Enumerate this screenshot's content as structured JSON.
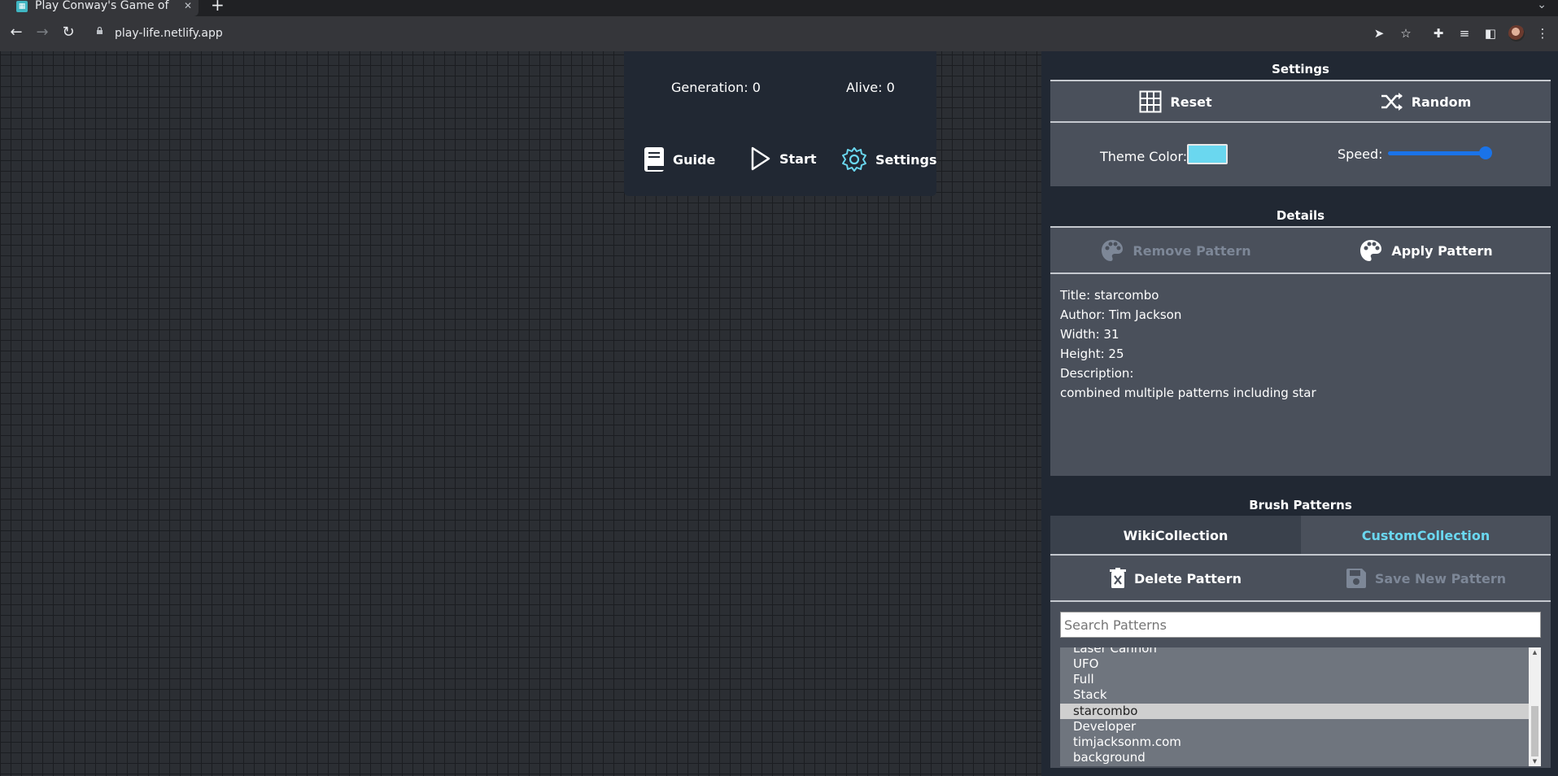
{
  "browser": {
    "tab_title": "Play Conway's Game of Life",
    "url": "play-life.netlify.app"
  },
  "top_panel": {
    "generation_label": "Generation: 0",
    "alive_label": "Alive: 0",
    "guide_label": "Guide",
    "start_label": "Start",
    "settings_label": "Settings"
  },
  "settings": {
    "title": "Settings",
    "reset_label": "Reset",
    "random_label": "Random",
    "theme_color_label": "Theme Color:",
    "theme_color": "#6ad7ef",
    "speed_label": "Speed:",
    "speed_value": 1.0
  },
  "details": {
    "title": "Details",
    "remove_label": "Remove Pattern",
    "apply_label": "Apply Pattern",
    "lines": [
      "Title: starcombo",
      "Author: Tim Jackson",
      "Width: 31",
      "Height: 25",
      "Description:",
      "combined multiple patterns including star"
    ]
  },
  "brush": {
    "title": "Brush Patterns",
    "tab_wiki": "WikiCollection",
    "tab_custom": "CustomCollection",
    "delete_label": "Delete Pattern",
    "save_label": "Save New Pattern",
    "search_placeholder": "Search Patterns",
    "items": [
      "Laser Cannon",
      "UFO",
      "Full",
      "Stack",
      "starcombo",
      "Developer",
      "timjacksonm.com",
      "background"
    ],
    "selected": "starcombo"
  },
  "colors": {
    "accent": "#6ad7ef",
    "panel_bg": "#212833",
    "box_bg": "#4a505b",
    "slider": "#1a73e8"
  }
}
